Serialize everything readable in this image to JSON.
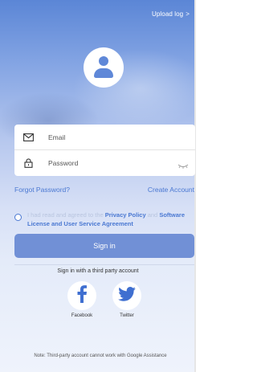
{
  "header": {
    "upload_log_label": "Upload log",
    "upload_log_chevron": ">"
  },
  "avatar": {
    "icon": "user-icon"
  },
  "form": {
    "email_placeholder": "Email",
    "email_icon": "mail-icon",
    "password_placeholder": "Password",
    "password_icon": "lock-icon",
    "password_toggle_icon": "eye-closed-icon"
  },
  "links": {
    "forgot_password": "Forgot Password?",
    "create_account": "Create Account"
  },
  "agreement": {
    "prefix": "I had read and agreed to the ",
    "privacy_policy": "Privacy Policy",
    "and_word": " and ",
    "license_agreement": "Software License and User Service Agreement"
  },
  "signin": {
    "label": "Sign in"
  },
  "third_party": {
    "title": "Sign in with a third party account",
    "facebook_label": "Facebook",
    "twitter_label": "Twitter",
    "note": "Note: Third-party account cannot work with Google Assistance"
  },
  "colors": {
    "accent": "#4a78d2",
    "button": "#7190d6",
    "facebook": "#3f6fd0",
    "twitter": "#3f6fd0"
  }
}
